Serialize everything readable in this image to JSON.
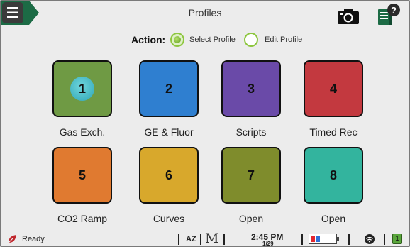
{
  "header": {
    "title": "Profiles",
    "menu_icon": "hamburger-icon",
    "camera_icon": "camera-icon",
    "help_icon": "help-book-icon"
  },
  "action": {
    "label": "Action:",
    "options": [
      {
        "label": "Select Profile",
        "selected": true
      },
      {
        "label": "Edit Profile",
        "selected": false
      }
    ]
  },
  "profiles": [
    {
      "number": "1",
      "label": "Gas Exch.",
      "color": "#6f9a44",
      "selected": true
    },
    {
      "number": "2",
      "label": "GE & Fluor",
      "color": "#2f7fd0",
      "selected": false
    },
    {
      "number": "3",
      "label": "Scripts",
      "color": "#6a4aa8",
      "selected": false
    },
    {
      "number": "4",
      "label": "Timed Rec",
      "color": "#c3393f",
      "selected": false
    },
    {
      "number": "5",
      "label": "CO2 Ramp",
      "color": "#e07a30",
      "selected": false
    },
    {
      "number": "6",
      "label": "Curves",
      "color": "#d8a82c",
      "selected": false
    },
    {
      "number": "7",
      "label": "Open",
      "color": "#7f8c2c",
      "selected": false
    },
    {
      "number": "8",
      "label": "Open",
      "color": "#33b49e",
      "selected": false
    }
  ],
  "status": {
    "state": "Ready",
    "timezone": "AZ",
    "mode_letter": "M",
    "time": "2:45 PM",
    "date": "1/29",
    "badge": "1",
    "leaf_icon": "leaf-icon",
    "battery_icon": "battery-icon",
    "wifi_icon": "wifi-icon"
  }
}
